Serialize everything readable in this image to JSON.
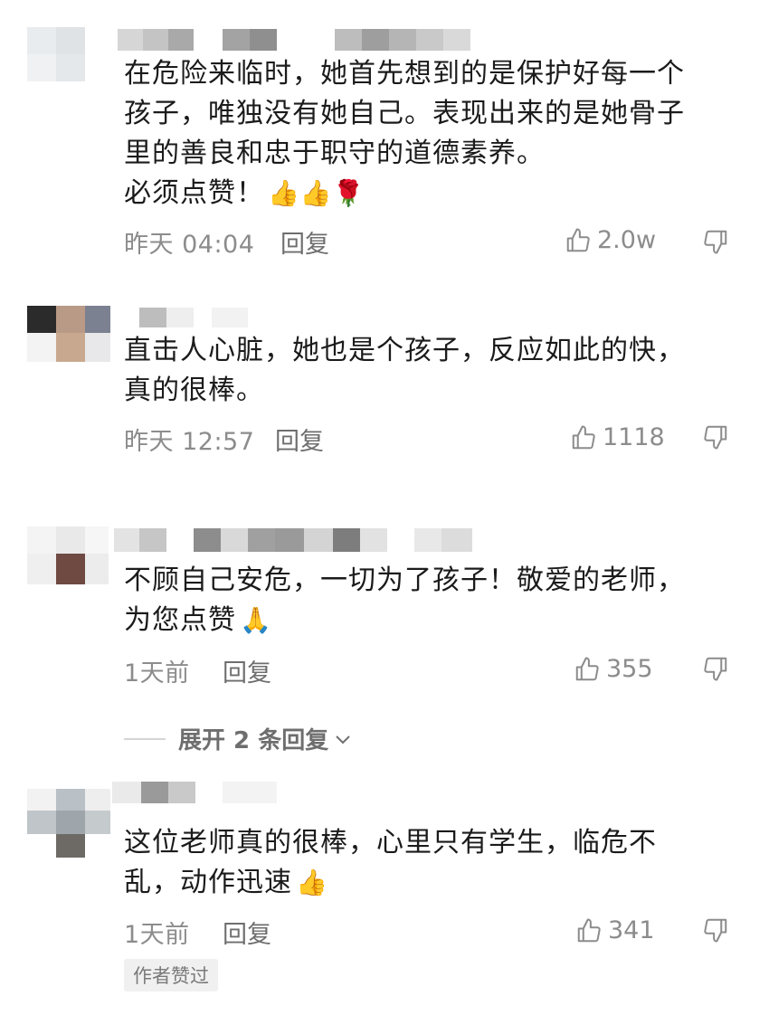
{
  "comments": [
    {
      "text_lines": [
        "在危险来临时，她首先想到的是保护好每一个",
        "孩子，唯独没有她自己。表现出来的是她骨子",
        "里的善良和忠于职守的道德素养。",
        "必须点赞！"
      ],
      "emoji": "👍👍🌹",
      "time": "昨天 04:04",
      "reply_label": "回复",
      "likes": "2.0w"
    },
    {
      "text_lines": [
        "直击人心脏，她也是个孩子，反应如此的快，",
        "真的很棒。"
      ],
      "emoji": "",
      "time": "昨天 12:57",
      "reply_label": "回复",
      "likes": "1118"
    },
    {
      "text_lines": [
        "不顾自己安危，一切为了孩子！敬爱的老师，",
        "为您点赞"
      ],
      "emoji": "🙏",
      "time": "1天前",
      "reply_label": "回复",
      "likes": "355"
    },
    {
      "text_lines": [
        "这位老师真的很棒，心里只有学生，临危不",
        "乱，动作迅速"
      ],
      "emoji": "👍",
      "time": "1天前",
      "reply_label": "回复",
      "likes": "341"
    }
  ],
  "expand_replies_label": "展开 2 条回复",
  "author_liked_badge": "作者赞过",
  "icons": {
    "like": "thumbs-up-outline-icon",
    "dislike": "thumbs-down-outline-icon",
    "expand": "chevron-down-icon"
  },
  "colors": {
    "text": "#1b1b1b",
    "meta": "#8c8c8c",
    "reply": "#6e6e6e",
    "badge_bg": "#f0f0f0"
  }
}
